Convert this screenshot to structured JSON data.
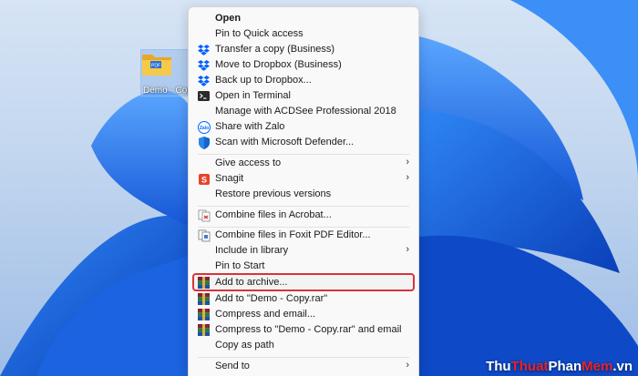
{
  "desktop": {
    "folder_label": "Demo - Copy",
    "folder_badge": "PDF"
  },
  "menu": {
    "items": [
      {
        "label": "Open",
        "icon": "none",
        "submenu": false
      },
      {
        "label": "Pin to Quick access",
        "icon": "none",
        "submenu": false
      },
      {
        "label": "Transfer a copy (Business)",
        "icon": "dropbox-icon",
        "submenu": false
      },
      {
        "label": "Move to Dropbox (Business)",
        "icon": "dropbox-icon",
        "submenu": false
      },
      {
        "label": "Back up to Dropbox...",
        "icon": "dropbox-icon",
        "submenu": false
      },
      {
        "label": "Open in Terminal",
        "icon": "terminal-icon",
        "submenu": false
      },
      {
        "label": "Manage with ACDSee Professional 2018",
        "icon": "none",
        "submenu": false
      },
      {
        "label": "Share with Zalo",
        "icon": "zalo-icon",
        "submenu": false
      },
      {
        "label": "Scan with Microsoft Defender...",
        "icon": "defender-shield-icon",
        "submenu": false
      },
      {
        "label": "Give access to",
        "icon": "none",
        "submenu": true
      },
      {
        "label": "Snagit",
        "icon": "snagit-icon",
        "submenu": true
      },
      {
        "label": "Restore previous versions",
        "icon": "none",
        "submenu": false
      },
      {
        "label": "Combine files in Acrobat...",
        "icon": "acrobat-icon",
        "submenu": false
      },
      {
        "label": "Combine files in Foxit PDF Editor...",
        "icon": "foxit-icon",
        "submenu": false
      },
      {
        "label": "Include in library",
        "icon": "none",
        "submenu": true
      },
      {
        "label": "Pin to Start",
        "icon": "none",
        "submenu": false
      },
      {
        "label": "Add to archive...",
        "icon": "winrar-icon",
        "submenu": false
      },
      {
        "label": "Add to \"Demo - Copy.rar\"",
        "icon": "winrar-icon",
        "submenu": false
      },
      {
        "label": "Compress and email...",
        "icon": "winrar-icon",
        "submenu": false
      },
      {
        "label": "Compress to \"Demo - Copy.rar\" and email",
        "icon": "winrar-icon",
        "submenu": false
      },
      {
        "label": "Copy as path",
        "icon": "none",
        "submenu": false
      },
      {
        "label": "Send to",
        "icon": "none",
        "submenu": true
      }
    ],
    "submenu_arrow": "›",
    "highlighted_item": "Add to archive..."
  },
  "watermark": {
    "part1": "Thu",
    "part2": "Thuat",
    "part3": "Phan",
    "part4": "Mem",
    "part5": ".vn"
  },
  "colors": {
    "highlight_border": "#d9343a",
    "dropbox": "#0061fe",
    "winrar": "#8b1e3f"
  }
}
